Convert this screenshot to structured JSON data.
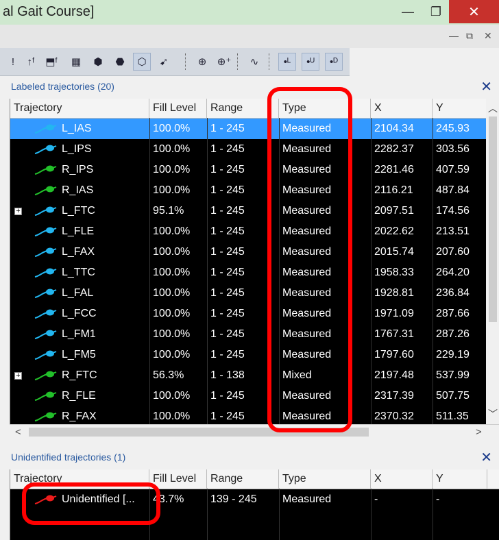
{
  "window": {
    "title": "al Gait Course]",
    "controls": {
      "minimize": "—",
      "maximize": "❐",
      "close": "✕"
    }
  },
  "subbar": {
    "minimize": "—",
    "restore": "⧉",
    "close": "✕"
  },
  "toolbar": {
    "buttons": [
      {
        "name": "marker-icon",
        "glyph": "!"
      },
      {
        "name": "force-arrow-icon",
        "glyph": "↑ᶠ"
      },
      {
        "name": "force-plate-icon",
        "glyph": "⬒ᶠ"
      },
      {
        "name": "grid-icon",
        "glyph": "▦"
      },
      {
        "name": "cube-icon",
        "glyph": "⬢"
      },
      {
        "name": "cube-small-icon",
        "glyph": "⬣"
      },
      {
        "name": "wireframe-cube-icon",
        "glyph": "⬡"
      },
      {
        "name": "cursor-icon",
        "glyph": "➹"
      },
      {
        "name": "crosshair-icon",
        "glyph": "⊕"
      },
      {
        "name": "crosshair-plus-icon",
        "glyph": "⊕⁺"
      },
      {
        "name": "waveform-icon",
        "glyph": "∿"
      },
      {
        "name": "labeled-marker-icon",
        "glyph": "•ᴸ"
      },
      {
        "name": "unlabeled-marker-icon",
        "glyph": "•ᵁ"
      },
      {
        "name": "discarded-marker-icon",
        "glyph": "•ᴰ"
      }
    ]
  },
  "labeled": {
    "title": "Labeled trajectories (20)",
    "close": "✕",
    "columns": [
      "Trajectory",
      "Fill Level",
      "Range",
      "Type",
      "X",
      "Y"
    ],
    "rows": [
      {
        "name": "L_IAS",
        "fill": "100.0%",
        "range": "1 - 245",
        "type": "Measured",
        "x": "2104.34",
        "y": "245.93",
        "color": "#22b6f0",
        "selected": true,
        "expand": ""
      },
      {
        "name": "L_IPS",
        "fill": "100.0%",
        "range": "1 - 245",
        "type": "Measured",
        "x": "2282.37",
        "y": "303.56",
        "color": "#22b6f0",
        "selected": false,
        "expand": ""
      },
      {
        "name": "R_IPS",
        "fill": "100.0%",
        "range": "1 - 245",
        "type": "Measured",
        "x": "2281.46",
        "y": "407.59",
        "color": "#22c02a",
        "selected": false,
        "expand": ""
      },
      {
        "name": "R_IAS",
        "fill": "100.0%",
        "range": "1 - 245",
        "type": "Measured",
        "x": "2116.21",
        "y": "487.84",
        "color": "#22c02a",
        "selected": false,
        "expand": ""
      },
      {
        "name": "L_FTC",
        "fill": "95.1%",
        "range": "1 - 245",
        "type": "Measured",
        "x": "2097.51",
        "y": "174.56",
        "color": "#22b6f0",
        "selected": false,
        "expand": "+"
      },
      {
        "name": "L_FLE",
        "fill": "100.0%",
        "range": "1 - 245",
        "type": "Measured",
        "x": "2022.62",
        "y": "213.51",
        "color": "#22b6f0",
        "selected": false,
        "expand": ""
      },
      {
        "name": "L_FAX",
        "fill": "100.0%",
        "range": "1 - 245",
        "type": "Measured",
        "x": "2015.74",
        "y": "207.60",
        "color": "#22b6f0",
        "selected": false,
        "expand": ""
      },
      {
        "name": "L_TTC",
        "fill": "100.0%",
        "range": "1 - 245",
        "type": "Measured",
        "x": "1958.33",
        "y": "264.20",
        "color": "#22b6f0",
        "selected": false,
        "expand": ""
      },
      {
        "name": "L_FAL",
        "fill": "100.0%",
        "range": "1 - 245",
        "type": "Measured",
        "x": "1928.81",
        "y": "236.84",
        "color": "#22b6f0",
        "selected": false,
        "expand": ""
      },
      {
        "name": "L_FCC",
        "fill": "100.0%",
        "range": "1 - 245",
        "type": "Measured",
        "x": "1971.09",
        "y": "287.66",
        "color": "#22b6f0",
        "selected": false,
        "expand": ""
      },
      {
        "name": "L_FM1",
        "fill": "100.0%",
        "range": "1 - 245",
        "type": "Measured",
        "x": "1767.31",
        "y": "287.26",
        "color": "#22b6f0",
        "selected": false,
        "expand": ""
      },
      {
        "name": "L_FM5",
        "fill": "100.0%",
        "range": "1 - 245",
        "type": "Measured",
        "x": "1797.60",
        "y": "229.19",
        "color": "#22b6f0",
        "selected": false,
        "expand": ""
      },
      {
        "name": "R_FTC",
        "fill": "56.3%",
        "range": "1 - 138",
        "type": "Mixed",
        "x": "2197.48",
        "y": "537.99",
        "color": "#22c02a",
        "selected": false,
        "expand": "+"
      },
      {
        "name": "R_FLE",
        "fill": "100.0%",
        "range": "1 - 245",
        "type": "Measured",
        "x": "2317.39",
        "y": "507.75",
        "color": "#22c02a",
        "selected": false,
        "expand": ""
      },
      {
        "name": "R_FAX",
        "fill": "100.0%",
        "range": "1 - 245",
        "type": "Measured",
        "x": "2370.32",
        "y": "511.35",
        "color": "#22c02a",
        "selected": false,
        "expand": ""
      }
    ]
  },
  "unidentified": {
    "title": "Unidentified trajectories (1)",
    "close": "✕",
    "columns": [
      "Trajectory",
      "Fill Level",
      "Range",
      "Type",
      "X",
      "Y"
    ],
    "rows": [
      {
        "name": "Unidentified [...",
        "fill": "43.7%",
        "range": "139 - 245",
        "type": "Measured",
        "x": "-",
        "y": "-",
        "color": "#ee1c1c",
        "selected": false,
        "expand": ""
      }
    ]
  },
  "scroll": {
    "up": "︿",
    "down": "﹀",
    "left": "<",
    "right": ">"
  },
  "colors": {
    "highlight": "#ff0000",
    "selection": "#3399ff",
    "panel_title": "#2a5aa0"
  }
}
